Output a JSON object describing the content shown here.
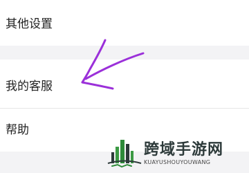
{
  "settings": {
    "items": [
      {
        "label": "其他设置"
      },
      {
        "label": "我的客服"
      },
      {
        "label": "帮助"
      }
    ]
  },
  "annotation": {
    "icon": "hand-drawn-arrow-icon",
    "color": "#9b30d9"
  },
  "watermark": {
    "title": "跨域手游网",
    "subtitle": "KUAYUSHOUYOUWANG",
    "icon": "city-skyline-logo-icon",
    "colors": {
      "green": "#2e8b3a",
      "dark": "#2d3a3a"
    }
  }
}
